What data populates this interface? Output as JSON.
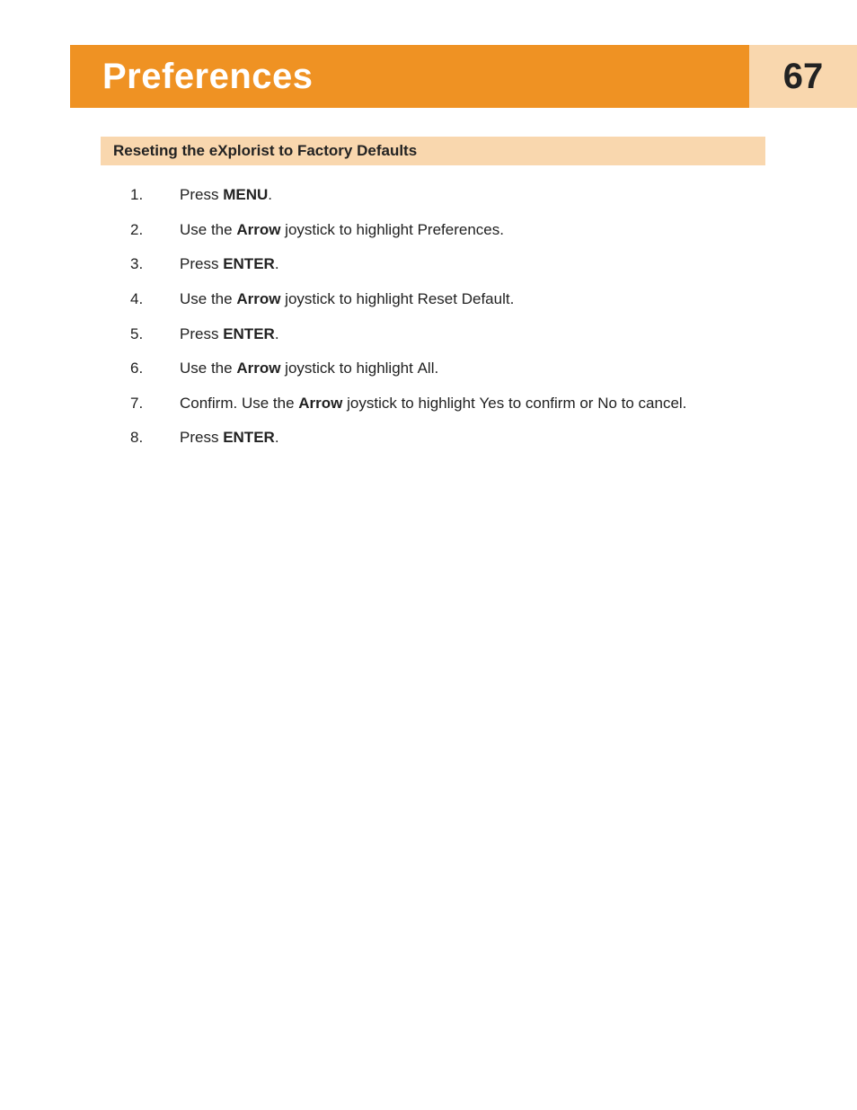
{
  "header": {
    "title": "Preferences",
    "page_number": "67"
  },
  "section": {
    "heading": "Reseting the eXplorist to Factory Defaults"
  },
  "steps": [
    {
      "num": "1.",
      "segments": [
        {
          "t": "Press ",
          "cls": ""
        },
        {
          "t": "MENU",
          "cls": "b"
        },
        {
          "t": ".",
          "cls": ""
        }
      ]
    },
    {
      "num": "2.",
      "segments": [
        {
          "t": "Use the ",
          "cls": ""
        },
        {
          "t": "Arrow",
          "cls": "b"
        },
        {
          "t": " joystick to highlight ",
          "cls": ""
        },
        {
          "t": "Preferences",
          "cls": "ui"
        },
        {
          "t": ".",
          "cls": ""
        }
      ]
    },
    {
      "num": "3.",
      "segments": [
        {
          "t": "Press ",
          "cls": ""
        },
        {
          "t": "ENTER",
          "cls": "b"
        },
        {
          "t": ".",
          "cls": ""
        }
      ]
    },
    {
      "num": "4.",
      "segments": [
        {
          "t": "Use the ",
          "cls": ""
        },
        {
          "t": "Arrow",
          "cls": "b"
        },
        {
          "t": " joystick to highlight ",
          "cls": ""
        },
        {
          "t": "Reset Default",
          "cls": "ui"
        },
        {
          "t": ".",
          "cls": ""
        }
      ]
    },
    {
      "num": "5.",
      "segments": [
        {
          "t": "Press ",
          "cls": ""
        },
        {
          "t": "ENTER",
          "cls": "b"
        },
        {
          "t": ".",
          "cls": ""
        }
      ]
    },
    {
      "num": "6.",
      "segments": [
        {
          "t": "Use the ",
          "cls": ""
        },
        {
          "t": "Arrow",
          "cls": "b"
        },
        {
          "t": " joystick to highlight ",
          "cls": ""
        },
        {
          "t": "All",
          "cls": "ui"
        },
        {
          "t": ".",
          "cls": ""
        }
      ]
    },
    {
      "num": "7.",
      "segments": [
        {
          "t": "Confirm.  Use the ",
          "cls": ""
        },
        {
          "t": "Arrow",
          "cls": "b"
        },
        {
          "t": " joystick to highlight ",
          "cls": ""
        },
        {
          "t": "Yes",
          "cls": "ui"
        },
        {
          "t": " to confirm or ",
          "cls": ""
        },
        {
          "t": "No",
          "cls": "ui"
        },
        {
          "t": " to cancel.",
          "cls": ""
        }
      ]
    },
    {
      "num": "8.",
      "segments": [
        {
          "t": "Press ",
          "cls": ""
        },
        {
          "t": "ENTER",
          "cls": "b"
        },
        {
          "t": ".",
          "cls": ""
        }
      ]
    }
  ]
}
